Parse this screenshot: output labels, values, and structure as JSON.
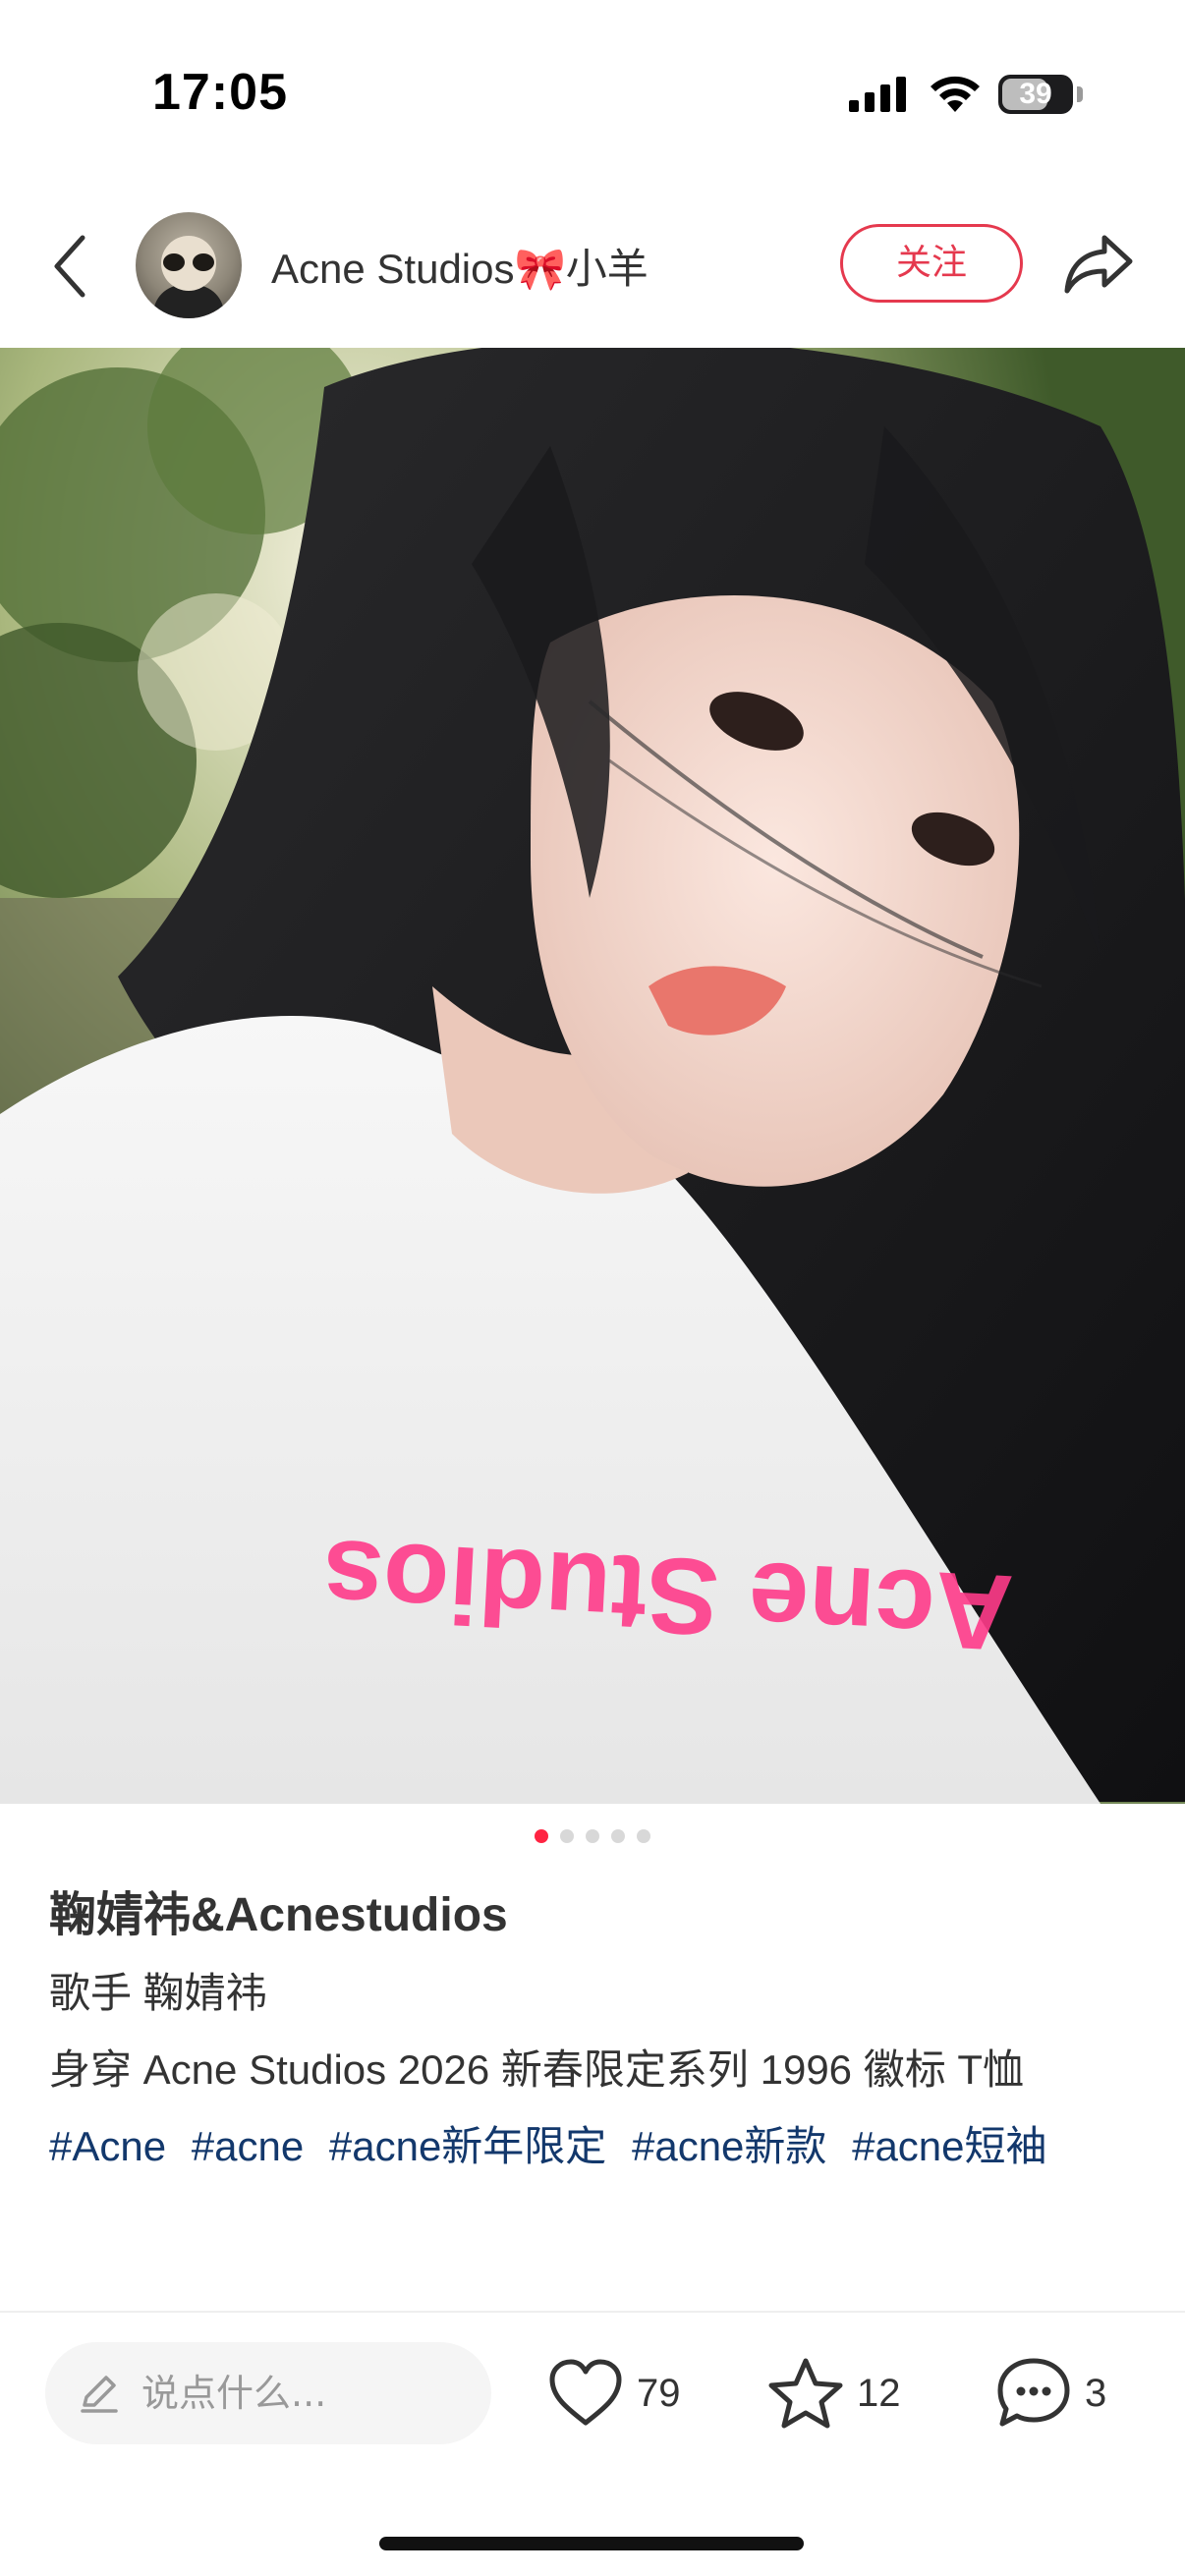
{
  "status_bar": {
    "time": "17:05",
    "battery_level": "39"
  },
  "header": {
    "author_name": "Acne Studios🎀小羊",
    "follow_label": "关注"
  },
  "photo": {
    "shirt_print_text": "Acne Studios",
    "page_count": 5,
    "current_page": 1
  },
  "post": {
    "title": "鞠婧祎&Acnestudios",
    "lines": [
      "歌手 鞠婧祎",
      "身穿 Acne Studios 2026 新春限定系列 1996 徽标 T恤"
    ],
    "tags": [
      "#Acne",
      "#acne",
      "#acne新年限定",
      "#acne新款",
      "#acne短袖"
    ]
  },
  "bottom_bar": {
    "comment_placeholder": "说点什么...",
    "like_count": "79",
    "collect_count": "12",
    "comment_count": "3"
  },
  "colors": {
    "accent": "#ff2442",
    "follow": "#e5394e",
    "tag": "#13386c"
  }
}
